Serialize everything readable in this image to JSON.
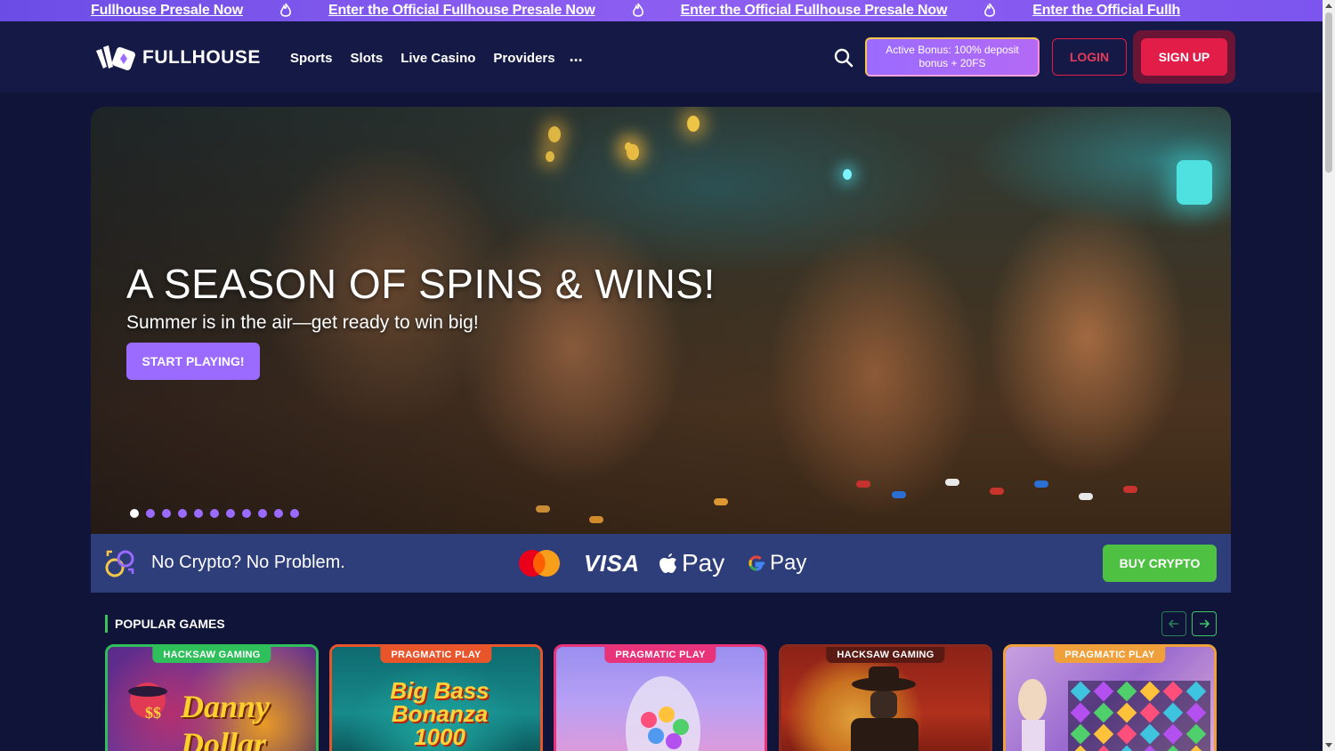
{
  "ticker": {
    "items": [
      "Fullhouse Presale Now",
      "Enter the Official Fullhouse Presale Now",
      "Enter the Official Fullhouse Presale Now",
      "Enter the Official Fullh"
    ]
  },
  "header": {
    "logo_text": "FULLHOUSE",
    "nav": [
      "Sports",
      "Slots",
      "Live Casino",
      "Providers",
      "..."
    ],
    "bonus_label": "Active Bonus: 100% deposit bonus + 20FS",
    "login_label": "LOGIN",
    "signup_label": "SIGN UP"
  },
  "hero": {
    "title": "A SEASON OF SPINS & WINS!",
    "subtitle": "Summer is in the air—get ready to win big!",
    "cta_label": "START PLAYING!",
    "slide_count": 11,
    "active_slide": 1
  },
  "crypto": {
    "text": "No Crypto? No Problem.",
    "payment_methods": [
      "mastercard",
      "VISA",
      "Pay",
      "Pay"
    ],
    "buy_label": "BUY CRYPTO"
  },
  "popular": {
    "title": "POPULAR GAMES",
    "games": [
      {
        "provider": "HACKSAW GAMING",
        "title": "Danny Dollar",
        "accent": "#2fbf5b"
      },
      {
        "provider": "PRAGMATIC PLAY",
        "title": "Big Bass Bonanza 1000",
        "accent": "#e8552b"
      },
      {
        "provider": "PRAGMATIC PLAY",
        "title": "",
        "accent": "#e8327a"
      },
      {
        "provider": "HACKSAW GAMING",
        "title": "",
        "accent": "#8a2a1e"
      },
      {
        "provider": "PRAGMATIC PLAY",
        "title": "",
        "accent": "#f0a03a"
      }
    ]
  },
  "colors": {
    "background": "#0f1438",
    "header": "#141a45",
    "accent_purple": "#9b6bff",
    "signup_red": "#e11d48",
    "buy_green": "#4fc142"
  }
}
